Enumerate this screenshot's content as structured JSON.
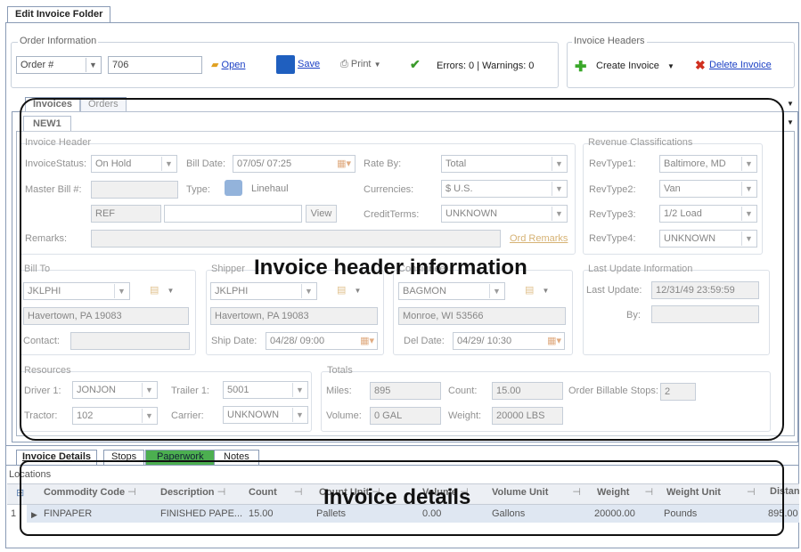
{
  "window": {
    "tab_title": "Edit Invoice Folder"
  },
  "order_info": {
    "title": "Order Information",
    "type_value": "Order #",
    "number_value": "706",
    "open_label": "Open",
    "save_label": "Save",
    "print_label": "Print",
    "status_text": "Errors: 0 | Warnings: 0"
  },
  "invoice_headers": {
    "title": "Invoice Headers",
    "create_label": "Create Invoice",
    "delete_label": "Delete Invoice"
  },
  "main_tabs": [
    {
      "label": "Invoices"
    },
    {
      "label": "Orders"
    }
  ],
  "invoice_tab": {
    "label": "NEW1"
  },
  "invoice_header": {
    "title": "Invoice Header",
    "status_label": "InvoiceStatus:",
    "status_value": "On Hold",
    "bill_date_label": "Bill Date:",
    "bill_date_value": "07/05/   07:25",
    "rate_by_label": "Rate By:",
    "rate_by_value": "Total",
    "master_bill_label": "Master Bill #:",
    "master_bill_value": "",
    "type_label": "Type:",
    "type_value": "Linehaul",
    "currencies_label": "Currencies:",
    "currencies_value": "$ U.S.",
    "ref_value": "REF",
    "ref2_value": "",
    "view_label": "View",
    "credit_terms_label": "CreditTerms:",
    "credit_terms_value": "UNKNOWN",
    "remarks_label": "Remarks:",
    "remarks_value": "",
    "ord_remarks_label": "Ord Remarks"
  },
  "revenue": {
    "title": "Revenue Classifications",
    "rows": [
      {
        "label": "RevType1:",
        "value": "Baltimore, MD"
      },
      {
        "label": "RevType2:",
        "value": "Van"
      },
      {
        "label": "RevType3:",
        "value": "1/2 Load"
      },
      {
        "label": "RevType4:",
        "value": "UNKNOWN"
      }
    ]
  },
  "bill_to": {
    "title": "Bill To",
    "code": "JKLPHI",
    "address": "Havertown, PA 19083",
    "contact_label": "Contact:",
    "contact_value": ""
  },
  "shipper": {
    "title": "Shipper",
    "code": "JKLPHI",
    "address": "Havertown, PA 19083",
    "date_label": "Ship Date:",
    "date_value": "04/28/   09:00"
  },
  "consignee": {
    "title": "Consignee",
    "code": "BAGMON",
    "address": "Monroe, WI 53566",
    "date_label": "Del Date:",
    "date_value": "04/29/   10:30"
  },
  "last_update": {
    "title": "Last Update Information",
    "update_label": "Last Update:",
    "update_value": "12/31/49 23:59:59",
    "by_label": "By:",
    "by_value": ""
  },
  "resources": {
    "title": "Resources",
    "driver_label": "Driver 1:",
    "driver_value": "JONJON",
    "trailer_label": "Trailer 1:",
    "trailer_value": "5001",
    "tractor_label": "Tractor:",
    "tractor_value": "102",
    "carrier_label": "Carrier:",
    "carrier_value": "UNKNOWN"
  },
  "totals": {
    "title": "Totals",
    "miles_label": "Miles:",
    "miles_value": "895",
    "count_label": "Count:",
    "count_value": "15.00",
    "billable_label": "Order Billable Stops:",
    "billable_value": "2",
    "volume_label": "Volume:",
    "volume_value": "0 GAL",
    "weight_label": "Weight:",
    "weight_value": "20000 LBS"
  },
  "annotations": {
    "header_caption": "Invoice header information",
    "details_caption": "Invoice details"
  },
  "detail_tabs": [
    {
      "label": "Invoice Details"
    },
    {
      "label": "Stops"
    },
    {
      "label": "Paperwork",
      "color": "#4caf50"
    },
    {
      "label": "Notes"
    }
  ],
  "locations_label": "Locations",
  "grid": {
    "columns": [
      "Commodity Code",
      "Description",
      "Count",
      "Count Unit",
      "Volume",
      "Volume Unit",
      "Weight",
      "Weight Unit",
      "Distance"
    ],
    "row": {
      "num": "1",
      "cells": [
        "FINPAPER",
        "FINISHED PAPE...",
        "15.00",
        "Pallets",
        "0.00",
        "Gallons",
        "20000.00",
        "Pounds",
        "895.00"
      ]
    }
  }
}
